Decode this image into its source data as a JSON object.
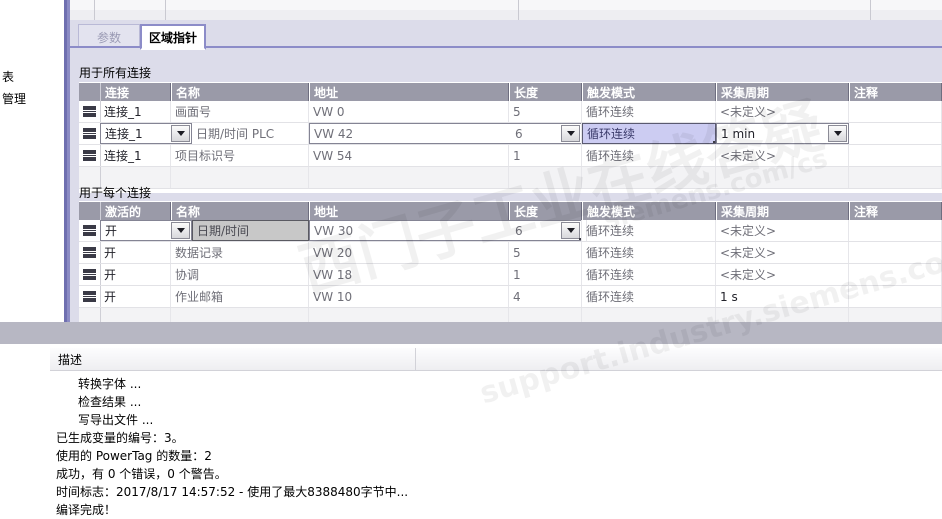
{
  "left_panel": {
    "labels": [
      "表",
      "管理"
    ]
  },
  "tabs": [
    {
      "label": "参数",
      "active": false
    },
    {
      "label": "区域指针",
      "active": true
    }
  ],
  "sections": [
    {
      "title": "用于所有连接",
      "columns": [
        "连接",
        "名称",
        "地址",
        "长度",
        "触发模式",
        "采集周期",
        "注释"
      ],
      "rows": [
        {
          "连接": "连接_1",
          "名称": "画面号",
          "地址": "VW 0",
          "长度": "5",
          "触发模式": "循环连续",
          "采集周期": "<未定义>",
          "注释": ""
        },
        {
          "连接": "连接_1",
          "名称": "日期/时间 PLC",
          "地址": "VW 42",
          "长度": "6",
          "触发模式": "循环连续",
          "采集周期": "1 min",
          "注释": ""
        },
        {
          "连接": "连接_1",
          "名称": "项目标识号",
          "地址": "VW 54",
          "长度": "1",
          "触发模式": "循环连续",
          "采集周期": "<未定义>",
          "注释": ""
        }
      ]
    },
    {
      "title": "用于每个连接",
      "columns": [
        "激活的",
        "名称",
        "地址",
        "长度",
        "触发模式",
        "采集周期",
        "注释"
      ],
      "rows": [
        {
          "激活的": "开",
          "名称": "日期/时间",
          "地址": "VW 30",
          "长度": "6",
          "触发模式": "循环连续",
          "采集周期": "<未定义>",
          "注释": ""
        },
        {
          "激活的": "开",
          "名称": "数据记录",
          "地址": "VW 20",
          "长度": "5",
          "触发模式": "循环连续",
          "采集周期": "<未定义>",
          "注释": ""
        },
        {
          "激活的": "开",
          "名称": "协调",
          "地址": "VW 18",
          "长度": "1",
          "触发模式": "循环连续",
          "采集周期": "<未定义>",
          "注释": ""
        },
        {
          "激活的": "开",
          "名称": "作业邮箱",
          "地址": "VW 10",
          "长度": "4",
          "触发模式": "循环连续",
          "采集周期": "1 s",
          "注释": ""
        }
      ]
    }
  ],
  "log": {
    "header_label": "描述",
    "lines": [
      {
        "text": "转换字体 ...",
        "indent": true
      },
      {
        "text": "检查结果 ...",
        "indent": true
      },
      {
        "text": "写导出文件 ...",
        "indent": true
      },
      {
        "text": "已生成变量的编号：3。",
        "indent": false
      },
      {
        "text": "使用的 PowerTag 的数量：2",
        "indent": false
      },
      {
        "text": "成功，有 0 个错误，0 个警告。",
        "indent": false
      },
      {
        "text": "时间标志：2017/8/17 14:57:52 - 使用了最大8388480字节中...",
        "indent": false
      },
      {
        "text": "编译完成！",
        "indent": false
      }
    ]
  },
  "watermark": {
    "line1": "西门子工业在线答疑",
    "line2": "support.industry.siemens.com/cs",
    "line3": "siemens.com/cs"
  },
  "colors": {
    "tab_accent": "#8c8cc8",
    "pane_bg": "#dcdcea",
    "header_bg": "#9a9aa8",
    "selection_lavender": "#ccccf2",
    "selection_gray": "#c8c8c8",
    "separator_band": "#b7b7c3"
  }
}
